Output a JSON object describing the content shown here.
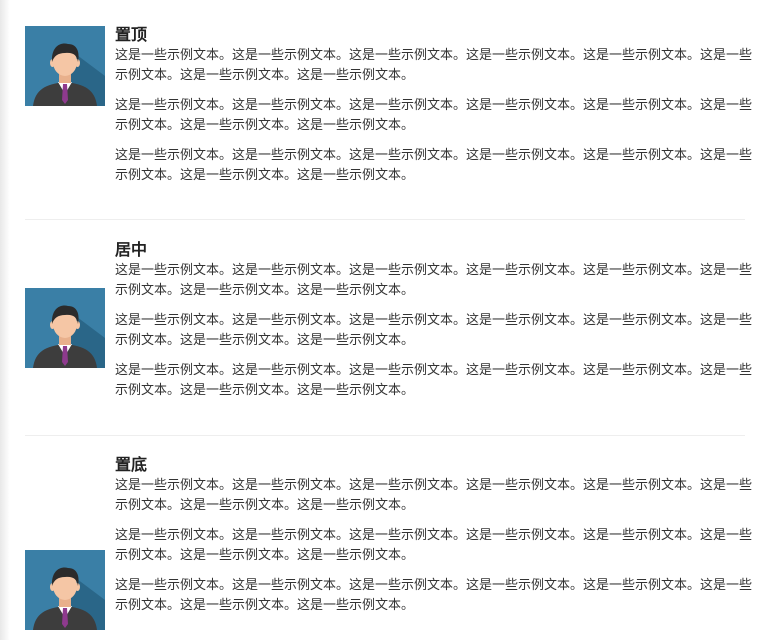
{
  "media_items": [
    {
      "heading": "置顶",
      "paragraphs": [
        "这是一些示例文本。这是一些示例文本。这是一些示例文本。这是一些示例文本。这是一些示例文本。这是一些示例文本。这是一些示例文本。这是一些示例文本。",
        "这是一些示例文本。这是一些示例文本。这是一些示例文本。这是一些示例文本。这是一些示例文本。这是一些示例文本。这是一些示例文本。这是一些示例文本。",
        "这是一些示例文本。这是一些示例文本。这是一些示例文本。这是一些示例文本。这是一些示例文本。这是一些示例文本。这是一些示例文本。这是一些示例文本。"
      ],
      "avatar_icon": "businessman-avatar-icon"
    },
    {
      "heading": "居中",
      "paragraphs": [
        "这是一些示例文本。这是一些示例文本。这是一些示例文本。这是一些示例文本。这是一些示例文本。这是一些示例文本。这是一些示例文本。这是一些示例文本。",
        "这是一些示例文本。这是一些示例文本。这是一些示例文本。这是一些示例文本。这是一些示例文本。这是一些示例文本。这是一些示例文本。这是一些示例文本。",
        "这是一些示例文本。这是一些示例文本。这是一些示例文本。这是一些示例文本。这是一些示例文本。这是一些示例文本。这是一些示例文本。这是一些示例文本。"
      ],
      "avatar_icon": "businessman-avatar-icon"
    },
    {
      "heading": "置底",
      "paragraphs": [
        "这是一些示例文本。这是一些示例文本。这是一些示例文本。这是一些示例文本。这是一些示例文本。这是一些示例文本。这是一些示例文本。这是一些示例文本。",
        "这是一些示例文本。这是一些示例文本。这是一些示例文本。这是一些示例文本。这是一些示例文本。这是一些示例文本。这是一些示例文本。这是一些示例文本。",
        "这是一些示例文本。这是一些示例文本。这是一些示例文本。这是一些示例文本。这是一些示例文本。这是一些示例文本。这是一些示例文本。这是一些示例文本。"
      ],
      "avatar_icon": "businessman-avatar-icon"
    }
  ],
  "colors": {
    "avatar_bg": "#3a7fa6",
    "avatar_shadow": "#2a6688",
    "suit": "#3d3d3d",
    "tie": "#8e3a8e",
    "skin": "#f5c6a5",
    "hair": "#2b2b2b",
    "divider": "#eeeeee"
  }
}
